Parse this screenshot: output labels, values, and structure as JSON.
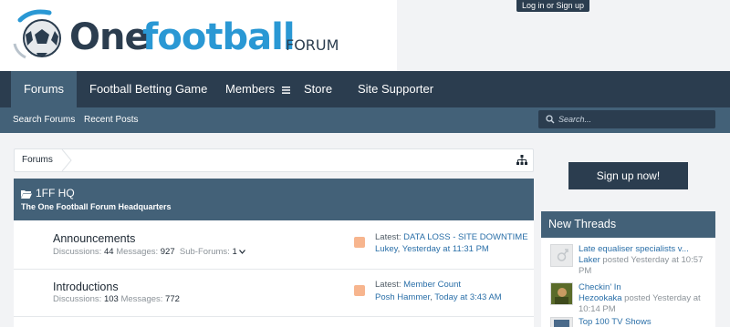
{
  "header": {
    "logo": {
      "one": "One",
      "football": "football",
      "forum": "FORUM"
    },
    "login_label": "Log in or Sign up"
  },
  "nav": {
    "tabs": [
      "Forums",
      "Football Betting Game",
      "Members",
      "Store",
      "Site Supporter"
    ],
    "active_tab": "Forums"
  },
  "subnav": {
    "links": [
      "Search Forums",
      "Recent Posts"
    ],
    "search_placeholder": "Search..."
  },
  "breadcrumb": {
    "items": [
      "Forums"
    ]
  },
  "category": {
    "title": "1FF HQ",
    "description": "The One Football Forum Headquarters"
  },
  "forums": [
    {
      "title": "Announcements",
      "discussions_label": "Discussions:",
      "discussions": "44",
      "messages_label": "Messages:",
      "messages": "927",
      "subforums_label": "Sub-Forums:",
      "subforums": "1",
      "latest_label": "Latest:",
      "latest_title": "DATA LOSS - SITE DOWNTIME",
      "latest_user": "Lukey",
      "latest_time": "Yesterday at 11:31 PM"
    },
    {
      "title": "Introductions",
      "discussions_label": "Discussions:",
      "discussions": "103",
      "messages_label": "Messages:",
      "messages": "772",
      "latest_label": "Latest:",
      "latest_title": "Member Count",
      "latest_user": "Posh Hammer",
      "latest_time": "Today at 3:43 AM"
    }
  ],
  "sidebar": {
    "signup_label": "Sign up now!",
    "new_threads_title": "New Threads",
    "threads": [
      {
        "title": "Late equaliser specialists v...",
        "user": "Laker",
        "meta": "posted Yesterday at 10:57 PM"
      },
      {
        "title": "Checkin' In",
        "user": "Hezookaka",
        "meta": "posted Yesterday at 10:14 PM"
      },
      {
        "title": "Top 100 TV Shows",
        "user": "",
        "meta": ""
      }
    ]
  },
  "colors": {
    "nav_dark": "#2b3d4f",
    "nav_mid": "#436178",
    "link": "#2a6fa8",
    "rss": "#f7b58e"
  }
}
